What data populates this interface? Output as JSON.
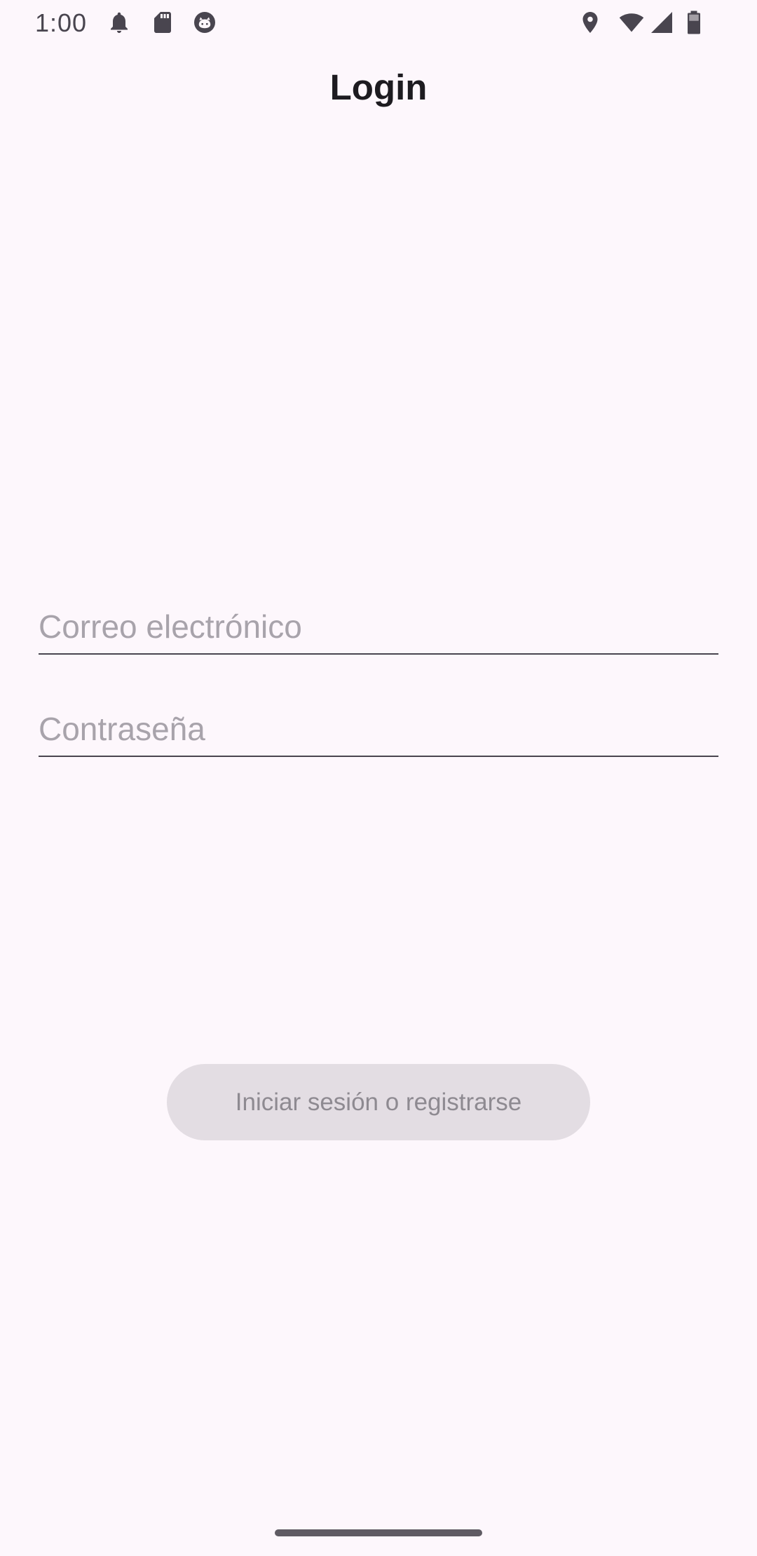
{
  "status_bar": {
    "time": "1:00",
    "icons": [
      "notification-bell-icon",
      "sd-card-icon",
      "cat-face-icon",
      "location-pin-icon",
      "wifi-icon",
      "signal-icon",
      "battery-icon"
    ]
  },
  "header": {
    "title": "Login"
  },
  "form": {
    "email": {
      "value": "",
      "placeholder": "Correo electrónico"
    },
    "password": {
      "value": "",
      "placeholder": "Contraseña"
    },
    "submit_label": "Iniciar sesión o registrarse"
  },
  "colors": {
    "background": "#fdf7fc",
    "button_disabled_bg": "#e3dde3",
    "button_disabled_text": "#8e8a91",
    "field_underline": "#49454f",
    "placeholder": "#a8a3ab"
  }
}
